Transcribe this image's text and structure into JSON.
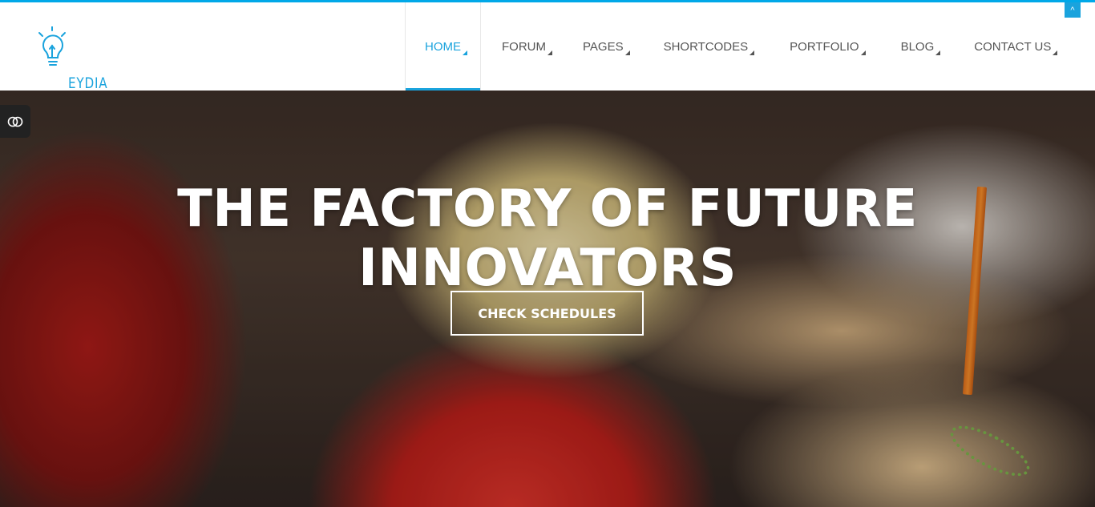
{
  "brand": {
    "name": "EYDIA",
    "accent": "#1aa3dd",
    "logo_icon": "lightbulb-icon"
  },
  "nav": {
    "items": [
      {
        "label": "HOME",
        "active": true
      },
      {
        "label": "FORUM",
        "active": false
      },
      {
        "label": "PAGES",
        "active": false
      },
      {
        "label": "SHORTCODES",
        "active": false
      },
      {
        "label": "PORTFOLIO",
        "active": false
      },
      {
        "label": "BLOG",
        "active": false
      },
      {
        "label": "CONTACT US",
        "active": false
      }
    ]
  },
  "scroll_top": {
    "icon": "chevron-up-icon",
    "glyph": "^"
  },
  "sidebar_toggle": {
    "icon": "toggle-icon"
  },
  "hero": {
    "title": "THE FACTORY OF FUTURE INNOVATORS",
    "cta_label": "CHECK SCHEDULES",
    "background": "child-writing-in-classroom-photo"
  }
}
